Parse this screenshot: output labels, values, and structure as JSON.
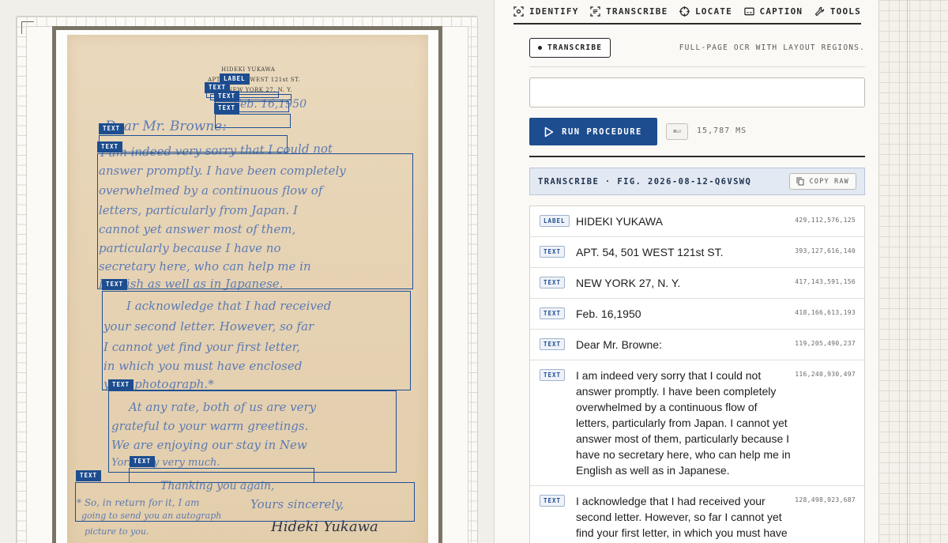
{
  "tabs": [
    {
      "label": "IDENTIFY",
      "icon": "identify-icon"
    },
    {
      "label": "TRANSCRIBE",
      "icon": "transcribe-icon"
    },
    {
      "label": "LOCATE",
      "icon": "locate-icon"
    },
    {
      "label": "CAPTION",
      "icon": "caption-icon"
    },
    {
      "label": "TOOLS",
      "icon": "wrench-icon"
    }
  ],
  "mode": {
    "chip_label": "TRANSCRIBE",
    "description": "FULL-PAGE OCR WITH LAYOUT REGIONS."
  },
  "prompt": {
    "value": "",
    "placeholder": ""
  },
  "run": {
    "label": "RUN PROCEDURE",
    "shortcut": "⌘⏎",
    "timing": "15,787 MS"
  },
  "result": {
    "title": "TRANSCRIBE · FIG. 2026-08-12-Q6VSWQ",
    "copy_label": "COPY RAW",
    "rows": [
      {
        "tag": "LABEL",
        "text": "HIDEKI YUKAWA",
        "coords": "429,112,576,125"
      },
      {
        "tag": "TEXT",
        "text": "APT. 54, 501 WEST 121st ST.",
        "coords": "393,127,616,140"
      },
      {
        "tag": "TEXT",
        "text": "NEW YORK 27, N. Y.",
        "coords": "417,143,591,156"
      },
      {
        "tag": "TEXT",
        "text": "Feb. 16,1950",
        "coords": "418,166,613,193"
      },
      {
        "tag": "TEXT",
        "text": "Dear Mr. Browne:",
        "coords": "119,205,490,237"
      },
      {
        "tag": "TEXT",
        "text": "I am indeed very sorry that I could not answer promptly. I have been completely overwhelmed by a continuous flow of letters, particularly from Japan. I cannot yet answer most of them, particularly because I have no secretary here, who can help me in English as well as in Japanese.",
        "coords": "116,240,930,497"
      },
      {
        "tag": "TEXT",
        "text": "I acknowledge that I had received your second letter. However, so far I cannot yet find your first letter, in which you must have enclosed your photograph *",
        "coords": "128,498,923,687"
      }
    ]
  },
  "document": {
    "letterhead": [
      "HIDEKI YUKAWA",
      "APT. 54, 501 WEST 121st ST.",
      "NEW YORK 27, N. Y."
    ],
    "handwriting": [
      "Feb. 16,1950",
      "Dear Mr. Browne:",
      "I am indeed very sorry that I could not",
      "answer promptly. I have been completely",
      "overwhelmed by a continuous flow of",
      "letters, particularly from Japan. I",
      "cannot yet answer most of them,",
      "particularly because I have no",
      "secretary here, who can help me in",
      "English as well as in Japanese.",
      "I acknowledge that I had received",
      "your second letter. However, so far",
      "I cannot yet find your first letter,",
      "in which you must have enclosed",
      "your photograph.*",
      "At any rate, both of us are very",
      "grateful to your warm greetings.",
      "We are enjoying our stay in New",
      "York City very much.",
      "Thanking you again,",
      "* So, in return for it, I am",
      "Yours sincerely,",
      "going to send you an autograph",
      "picture to you."
    ],
    "signature": "Hideki Yukawa"
  },
  "regions": [
    {
      "tag": "LABEL"
    },
    {
      "tag": "TEXT"
    },
    {
      "tag": "TEXT"
    },
    {
      "tag": "TEXT"
    },
    {
      "tag": "TEXT"
    },
    {
      "tag": "TEXT"
    },
    {
      "tag": "TEXT"
    },
    {
      "tag": "TEXT"
    },
    {
      "tag": "TEXT"
    },
    {
      "tag": "TEXT"
    }
  ],
  "colors": {
    "accent": "#1d4d8f",
    "region_tag": "#1d4d8f",
    "ink": "#4a6fb3"
  }
}
